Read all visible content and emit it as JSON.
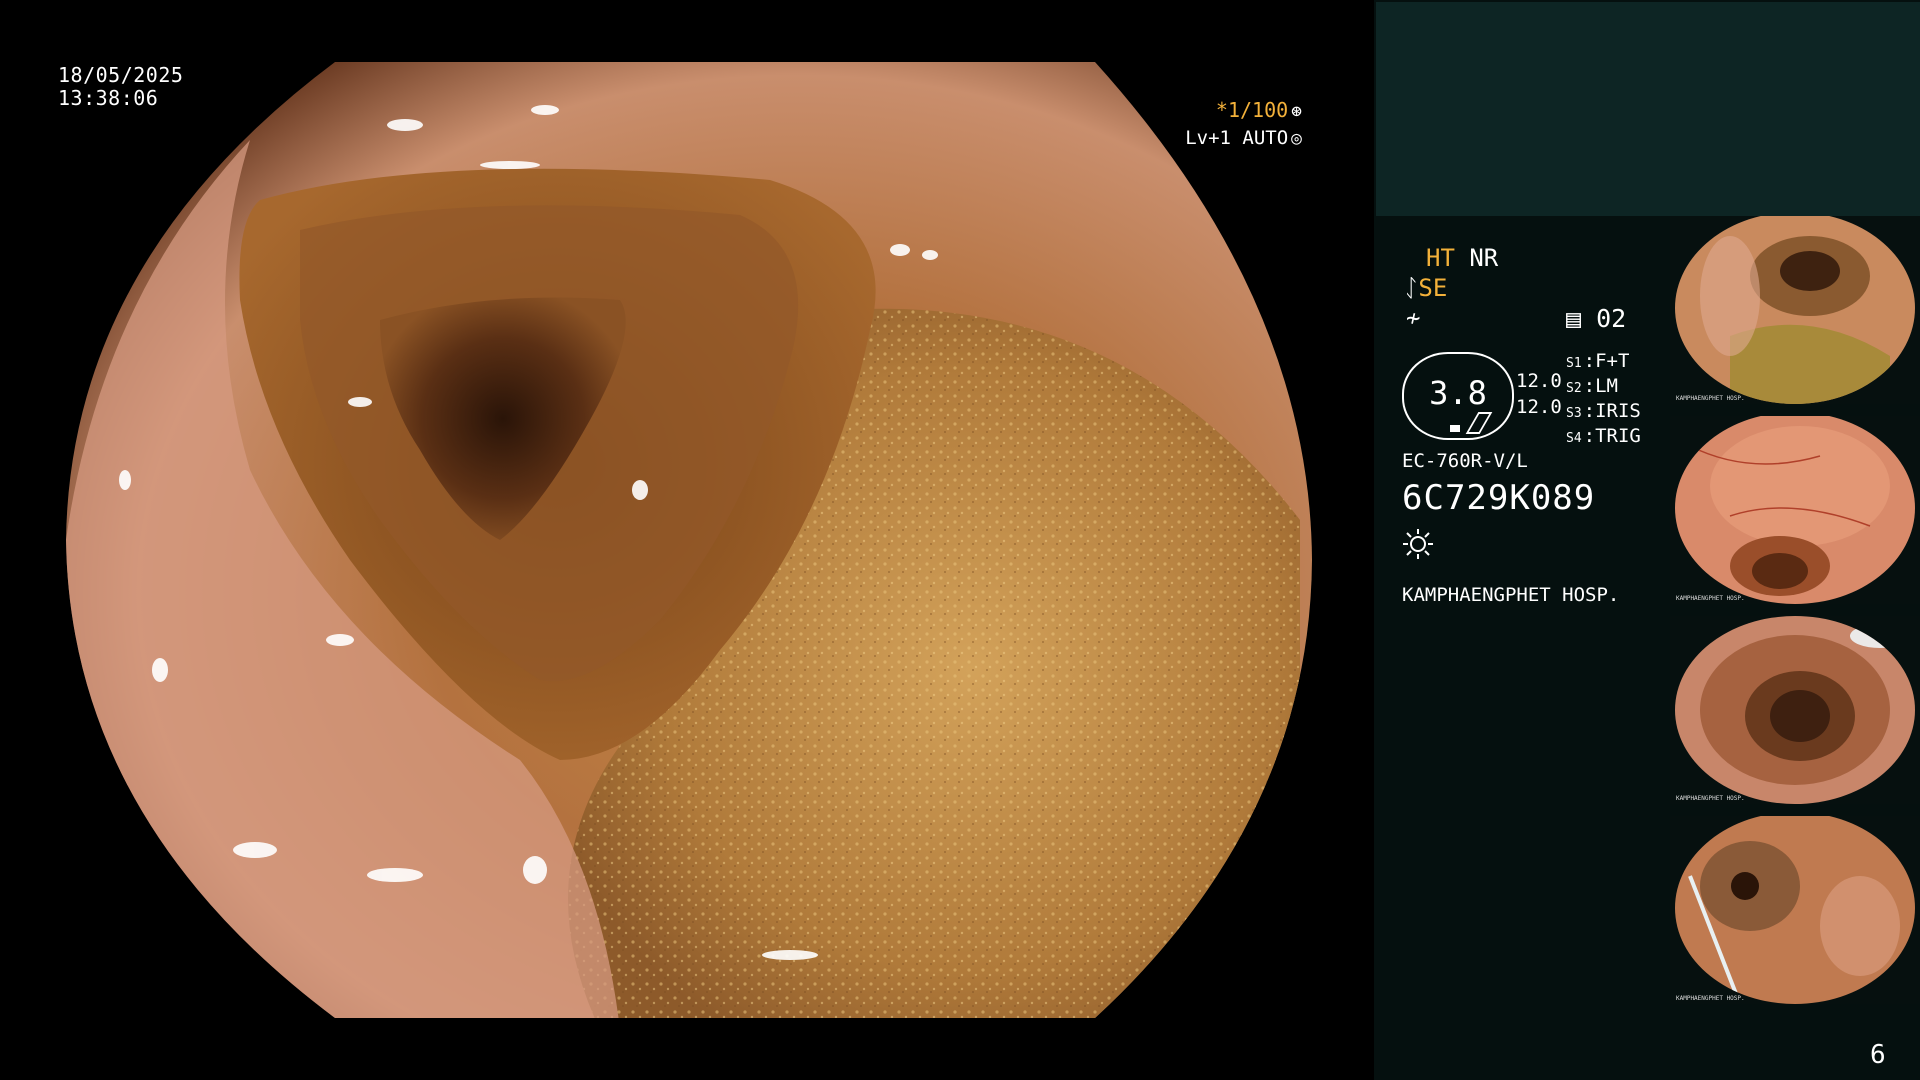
{
  "datetime": {
    "date": "18/05/2025",
    "time": "13:38:06"
  },
  "osd": {
    "shutter": "*1/100",
    "level": "Lv+1 AUTO"
  },
  "info": {
    "ht_label": "HT",
    "nr_label": "NR",
    "se_label": "SE",
    "memo": "02",
    "zoom_value": "3.8",
    "value_1": "12.0",
    "value_2": "12.0",
    "switches": [
      {
        "key": "S1",
        "value": "F+T"
      },
      {
        "key": "S2",
        "value": "LM"
      },
      {
        "key": "S3",
        "value": "IRIS"
      },
      {
        "key": "S4",
        "value": "TRIG"
      }
    ],
    "model": "EC-760R-V/L",
    "serial": "6C729K089",
    "hospital": "KAMPHAENGPHET HOSP."
  },
  "thumbnails": [
    {
      "caption": "KAMPHAENGPHET HOSP."
    },
    {
      "caption": "KAMPHAENGPHET HOSP."
    },
    {
      "caption": "KAMPHAENGPHET HOSP."
    },
    {
      "caption": "KAMPHAENGPHET HOSP."
    }
  ],
  "page_number": "6",
  "icons": [
    "aperture-icon",
    "auto-iris-icon",
    "scope-icon",
    "signal-icon",
    "memo-icon",
    "light-icon"
  ]
}
